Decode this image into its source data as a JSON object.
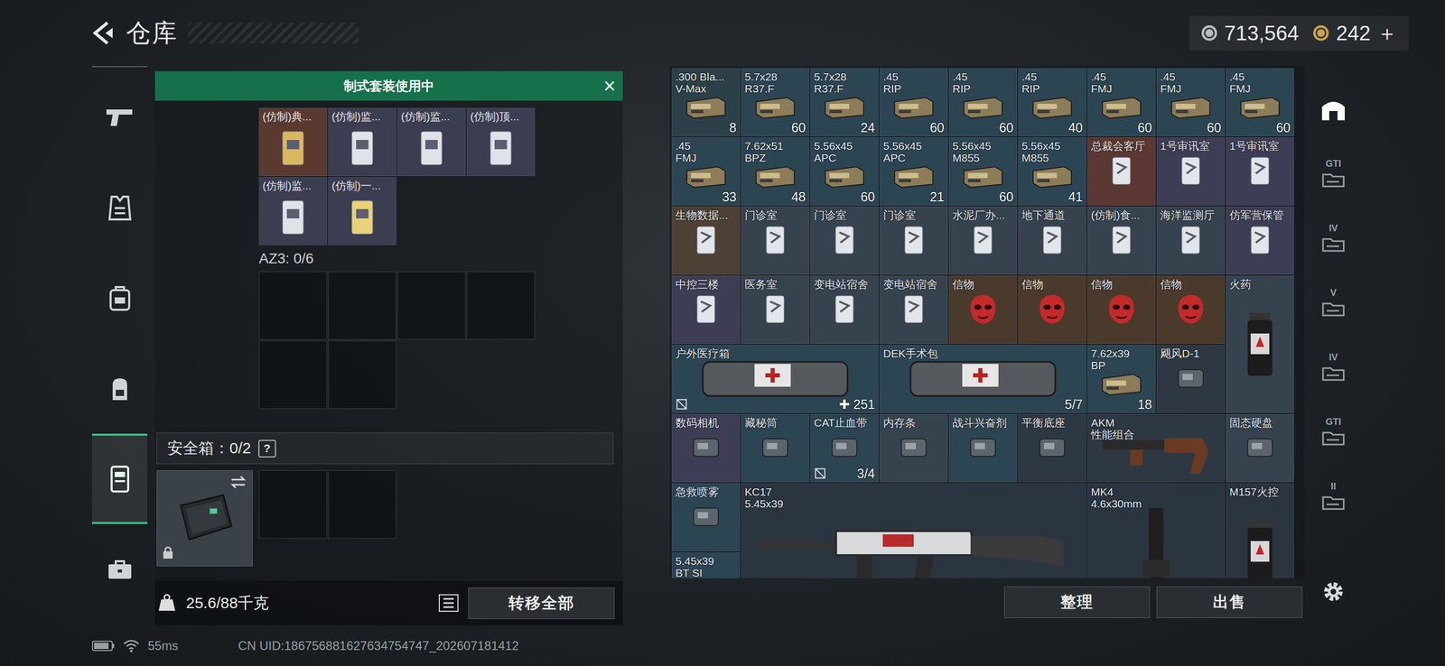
{
  "topbar": {
    "back": "<",
    "title": "仓库",
    "currencies": [
      {
        "value": "713,564",
        "color": "#b8bcc0"
      },
      {
        "value": "242",
        "color": "#c9a24a"
      }
    ],
    "add": "＋"
  },
  "nav": {
    "items": [
      {
        "selected": false
      },
      {
        "selected": false
      },
      {
        "selected": false
      },
      {
        "selected": false
      },
      {
        "selected": true
      },
      {
        "selected": false
      }
    ]
  },
  "loadout": {
    "header": "制式套装使用中",
    "close": "×",
    "items": [
      {
        "label": "(仿制)典...",
        "color": "#5a3a30"
      },
      {
        "label": "(仿制)监...",
        "color": "#3b3d50"
      },
      {
        "label": "(仿制)监...",
        "color": "#3b3d50"
      },
      {
        "label": "(仿制)顶...",
        "color": "#3b3d50"
      },
      {
        "label": "(仿制)监...",
        "color": "#3b3d50"
      },
      {
        "label": "(仿制)一...",
        "color": "#3b3d50"
      }
    ],
    "az3": {
      "label": "AZ3: 0/6",
      "empty_slots": 6
    },
    "safe": {
      "label": "安全箱：0/2",
      "help": "?",
      "locked": true,
      "empty_slots": 2
    },
    "weight": "25.6/88千克",
    "transfer": "转移全部"
  },
  "storage": {
    "items": [
      {
        "label": ".300 Bla...\nV-Max",
        "count": "8",
        "kind": "ammo",
        "color": "#2b4048",
        "tagged": false
      },
      {
        "label": "5.7x28\nR37.F",
        "count": "60",
        "kind": "ammo",
        "color": "#2c4553",
        "tagged": false
      },
      {
        "label": "5.7x28\nR37.F",
        "count": "24",
        "kind": "ammo",
        "color": "#2c4553",
        "tagged": false
      },
      {
        "label": ".45\nRIP",
        "count": "60",
        "kind": "ammo",
        "color": "#2c4553",
        "tagged": false
      },
      {
        "label": ".45\nRIP",
        "count": "60",
        "kind": "ammo",
        "color": "#2c4553",
        "tagged": false
      },
      {
        "label": ".45\nRIP",
        "count": "40",
        "kind": "ammo",
        "color": "#2c4553",
        "tagged": false
      },
      {
        "label": ".45\nFMJ",
        "count": "60",
        "kind": "ammo",
        "color": "#2c4553",
        "tagged": false
      },
      {
        "label": ".45\nFMJ",
        "count": "60",
        "kind": "ammo",
        "color": "#2c4553",
        "tagged": false
      },
      {
        "label": ".45\nFMJ",
        "count": "60",
        "kind": "ammo",
        "color": "#2c4553",
        "tagged": false
      },
      {
        "label": ".45\nFMJ",
        "count": "33",
        "kind": "ammo",
        "color": "#2c4553",
        "tagged": false
      },
      {
        "label": "7.62x51\nBPZ",
        "count": "48",
        "kind": "ammo",
        "color": "#2c4553",
        "tagged": false
      },
      {
        "label": "5.56x45\nAPC",
        "count": "60",
        "kind": "ammo",
        "color": "#2c4553",
        "tagged": false
      },
      {
        "label": "5.56x45\nAPC",
        "count": "21",
        "kind": "ammo",
        "color": "#2c4553",
        "tagged": false
      },
      {
        "label": "5.56x45\nM855",
        "count": "60",
        "kind": "ammo",
        "color": "#2c4553",
        "tagged": false
      },
      {
        "label": "5.56x45\nM855",
        "count": "41",
        "kind": "ammo",
        "color": "#2c4553",
        "tagged": false
      },
      {
        "label": "总裁会客厅",
        "count": "",
        "kind": "key",
        "color": "#5b3833",
        "tagged": false
      },
      {
        "label": "1号审讯室",
        "count": "",
        "kind": "key",
        "color": "#3d3d55",
        "tagged": false
      },
      {
        "label": "1号审讯室",
        "count": "",
        "kind": "key",
        "color": "#3d3d55",
        "tagged": false
      },
      {
        "label": "生物数据...",
        "count": "",
        "kind": "key",
        "color": "#4d4035",
        "tagged": false
      },
      {
        "label": "门诊室",
        "count": "",
        "kind": "key",
        "color": "#36434f",
        "tagged": false
      },
      {
        "label": "门诊室",
        "count": "",
        "kind": "key",
        "color": "#36434f",
        "tagged": false
      },
      {
        "label": "门诊室",
        "count": "",
        "kind": "key",
        "color": "#36434f",
        "tagged": false
      },
      {
        "label": "水泥厂办...",
        "count": "",
        "kind": "key",
        "color": "#36434f",
        "tagged": false
      },
      {
        "label": "地下通道",
        "count": "",
        "kind": "key",
        "color": "#36434f",
        "tagged": false
      },
      {
        "label": "(仿制)食...",
        "count": "",
        "kind": "key",
        "color": "#36434f",
        "tagged": false
      },
      {
        "label": "海洋监测厅",
        "count": "",
        "kind": "key",
        "color": "#36434f",
        "tagged": false
      },
      {
        "label": "仿军营保管",
        "count": "",
        "kind": "key",
        "color": "#3d3d55",
        "tagged": false
      },
      {
        "label": "中控三楼",
        "count": "",
        "kind": "key",
        "color": "#3d3d55",
        "tagged": false
      },
      {
        "label": "医务室",
        "count": "",
        "kind": "key",
        "color": "#36434f",
        "tagged": false
      },
      {
        "label": "变电站宿舍",
        "count": "",
        "kind": "key",
        "color": "#36434f",
        "tagged": false
      },
      {
        "label": "变电站宿舍",
        "count": "",
        "kind": "key",
        "color": "#36434f",
        "tagged": false
      },
      {
        "label": "信物",
        "count": "",
        "kind": "mask",
        "color": "#4a3a2c",
        "tagged": false
      },
      {
        "label": "信物",
        "count": "",
        "kind": "mask",
        "color": "#4a3a2c",
        "tagged": false
      },
      {
        "label": "信物",
        "count": "",
        "kind": "mask",
        "color": "#4a3a2c",
        "tagged": false
      },
      {
        "label": "信物",
        "count": "",
        "kind": "mask",
        "color": "#4a3a2c",
        "tagged": false
      },
      {
        "label": "火药",
        "count": "",
        "kind": "tall",
        "color": "#36434f",
        "tagged": false
      },
      {
        "label": "户外医疗箱",
        "count": "✚ 251",
        "kind": "kit",
        "color": "#2c4553",
        "tagged": true
      },
      {
        "label": "DEK手术包",
        "count": "5/7",
        "kind": "kit",
        "color": "#2c4553",
        "tagged": false
      },
      {
        "label": "7.62x39\nBP",
        "count": "18",
        "kind": "ammo",
        "color": "#2c4553",
        "tagged": false
      },
      {
        "label": "飓风D-1",
        "count": "",
        "kind": "item",
        "color": "#2e3842",
        "tagged": false
      },
      {
        "label": "数码相机",
        "count": "",
        "kind": "item",
        "color": "#3d3d55",
        "tagged": false
      },
      {
        "label": "藏秘筒",
        "count": "",
        "kind": "item",
        "color": "#2c4553",
        "tagged": false
      },
      {
        "label": "CAT止血带",
        "count": "3/4",
        "kind": "item",
        "color": "#2c4553",
        "tagged": true
      },
      {
        "label": "内存条",
        "count": "",
        "kind": "item",
        "color": "#36434f",
        "tagged": false
      },
      {
        "label": "战斗兴奋剂",
        "count": "",
        "kind": "item",
        "color": "#2c4553",
        "tagged": false
      },
      {
        "label": "平衡底座",
        "count": "",
        "kind": "item",
        "color": "#2e3842",
        "tagged": false
      },
      {
        "label": "AKM\n性能组合",
        "count": "",
        "kind": "wide",
        "color": "#2e3842",
        "tagged": false
      },
      {
        "label": "固态硬盘",
        "count": "",
        "kind": "item",
        "color": "#36434f",
        "tagged": false
      },
      {
        "label": "急救喷雾",
        "count": "",
        "kind": "item",
        "color": "#2c4553",
        "tagged": false
      },
      {
        "label": "KC17\n5.45x39",
        "count": "",
        "kind": "rifle",
        "color": "#2a3540",
        "tagged": false
      },
      {
        "label": "MK4\n4.6x30mm",
        "count": "",
        "kind": "block",
        "color": "#2a3540",
        "tagged": false
      },
      {
        "label": "M157火控",
        "count": "",
        "kind": "tall",
        "color": "#2a3540",
        "tagged": false
      },
      {
        "label": "5.45x39\nBT SI",
        "count": "",
        "kind": "ammo",
        "color": "#2c4553",
        "tagged": false
      }
    ],
    "buttons": [
      "整理",
      "出售"
    ]
  },
  "side_tabs": [
    {
      "selected": true
    },
    {
      "label": "GTI",
      "selected": false
    },
    {
      "label": "IV",
      "selected": false
    },
    {
      "label": "V",
      "selected": false
    },
    {
      "label": "IV",
      "selected": false
    },
    {
      "label": "GTI",
      "selected": false
    },
    {
      "label": "II",
      "selected": false
    }
  ],
  "status_bar": {
    "ping": "55ms",
    "uid": "CN UID:186756881627634754747_202607181412"
  }
}
